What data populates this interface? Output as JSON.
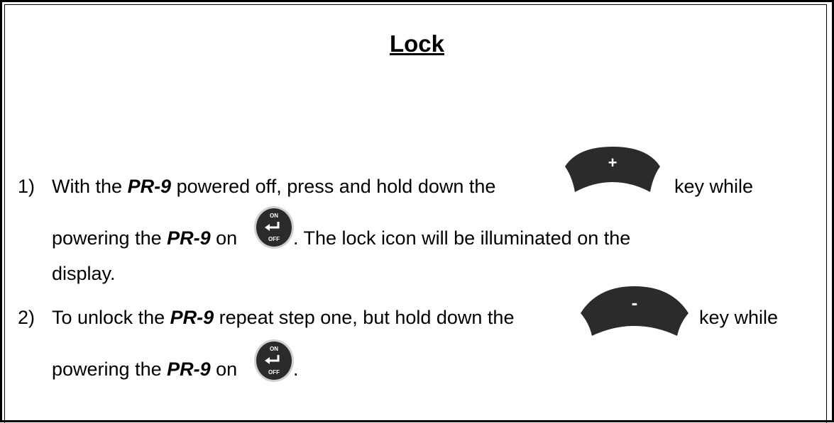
{
  "title": "Lock",
  "product": "PR-9",
  "steps": [
    {
      "number": "1)",
      "line1_a": "With the",
      "line1_b": "powered off, press and hold down the",
      "line1_c": "key while",
      "line2_a": "powering the",
      "line2_b": "on",
      "line2_c": ".  The lock icon will be illuminated on the",
      "line3": "display."
    },
    {
      "number": "2)",
      "line1_a": "To unlock the",
      "line1_b": "repeat step one, but hold down the",
      "line1_c": "key while",
      "line2_a": "powering the",
      "line2_b": "on",
      "line2_c": "."
    }
  ],
  "keys": {
    "plus": "+",
    "minus": "-",
    "on": "ON",
    "off": "OFF"
  },
  "colors": {
    "key_dark": "#2b2b2b",
    "key_gray": "#d0d0d0"
  }
}
